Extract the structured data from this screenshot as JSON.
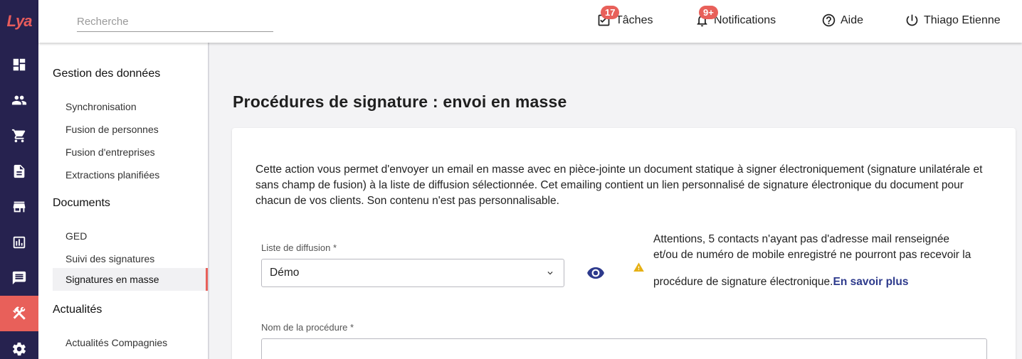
{
  "app": {
    "logo_text": "Lya"
  },
  "rail": {
    "icons": [
      "dashboard-icon",
      "people-icon",
      "cart-icon",
      "document-icon",
      "store-icon",
      "chart-icon",
      "message-icon",
      "tools-icon",
      "settings-icon"
    ],
    "active": "tools-icon",
    "active_color": "#e8605a",
    "bg_color": "#26224f"
  },
  "header": {
    "search_placeholder": "Recherche",
    "tasks": {
      "label": "Tâches",
      "badge": "17"
    },
    "notifications": {
      "label": "Notifications",
      "badge": "9+"
    },
    "help": {
      "label": "Aide"
    },
    "user": {
      "label": "Thiago Etienne"
    }
  },
  "subnav": {
    "sections": [
      {
        "title": "Gestion des données",
        "items": [
          "Synchronisation",
          "Fusion de personnes",
          "Fusion d'entreprises",
          "Extractions planifiées"
        ]
      },
      {
        "title": "Documents",
        "items": [
          "GED",
          "Suivi des signatures",
          "Signatures en masse"
        ]
      },
      {
        "title": "Actualités",
        "items": [
          "Actualités Compagnies"
        ]
      }
    ],
    "active_item": "Signatures en masse"
  },
  "main": {
    "title": "Procédures de signature : envoi en masse",
    "description": "Cette action vous permet d'envoyer un email en masse avec en pièce-jointe un document statique à signer électroniquement (signature unilatérale et sans champ de fusion) à la liste de diffusion sélectionnée. Cet emailing contient un lien personnalisé de signature électronique du document pour chacun de vos clients. Son contenu n'est pas personnalisable.",
    "list_label": "Liste de diffusion *",
    "list_value": "Démo",
    "warning_text_1": "Attentions, 5 contacts n'ayant pas d'adresse mail renseignée",
    "warning_text_2": "et/ou de numéro de mobile enregistré ne pourront pas recevoir la",
    "warning_text_3": "procédure de signature électronique.",
    "warning_link": "En savoir plus",
    "name_label": "Nom de la procédure *",
    "name_value": ""
  }
}
